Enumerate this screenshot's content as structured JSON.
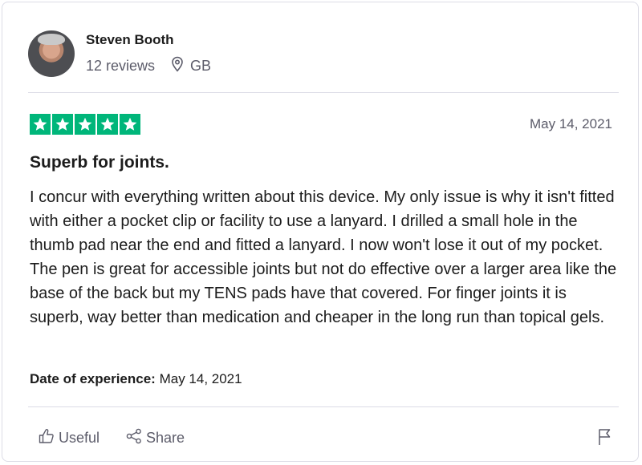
{
  "reviewer": {
    "name": "Steven Booth",
    "reviews": "12 reviews",
    "country": "GB"
  },
  "review": {
    "rating": 5,
    "rating_max": 5,
    "star_color": "#00b67a",
    "date": "May 14, 2021",
    "title": "Superb for joints.",
    "body": "I concur with everything written about this device. My only issue is why it isn't fitted with either a pocket clip or facility to use a lanyard. I drilled a small hole in the thumb pad near the end and fitted a lanyard. I now won't lose it out of my pocket. The pen is great for accessible joints but not do effective over a larger area like the base of the back but my TENS pads have that covered. For finger joints it is superb, way better than medication and cheaper in the long run than topical gels.",
    "experience_label": "Date of experience:",
    "experience_date": "May 14, 2021"
  },
  "actions": {
    "useful_label": "Useful",
    "share_label": "Share"
  },
  "icons": {
    "location": "location-pin-icon",
    "useful": "thumbs-up-icon",
    "share": "share-icon",
    "flag": "flag-icon"
  }
}
